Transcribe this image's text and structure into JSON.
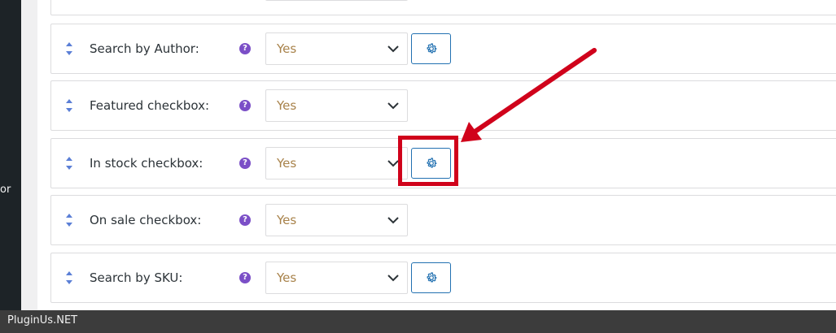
{
  "sidebar": {
    "stub_text": "or"
  },
  "rows": [
    {
      "label": "",
      "value": "",
      "has_settings": true
    },
    {
      "label": "Search by Author:",
      "value": "Yes",
      "has_settings": true
    },
    {
      "label": "Featured checkbox:",
      "value": "Yes",
      "has_settings": false
    },
    {
      "label": "In stock checkbox:",
      "value": "Yes",
      "has_settings": true
    },
    {
      "label": "On sale checkbox:",
      "value": "Yes",
      "has_settings": false
    },
    {
      "label": "Search by SKU:",
      "value": "Yes",
      "has_settings": true
    }
  ],
  "icons": {
    "sort": "sort-arrows-icon",
    "help": "question-mark-icon",
    "settings": "gear-icon",
    "dropdown": "chevron-down-icon"
  },
  "help_glyph": "?",
  "footer": {
    "text": "PluginUs.NET"
  },
  "colors": {
    "accent": "#2271b1",
    "help": "#7b4fc7",
    "value_text": "#a8824a",
    "annotation": "#d0021b"
  }
}
